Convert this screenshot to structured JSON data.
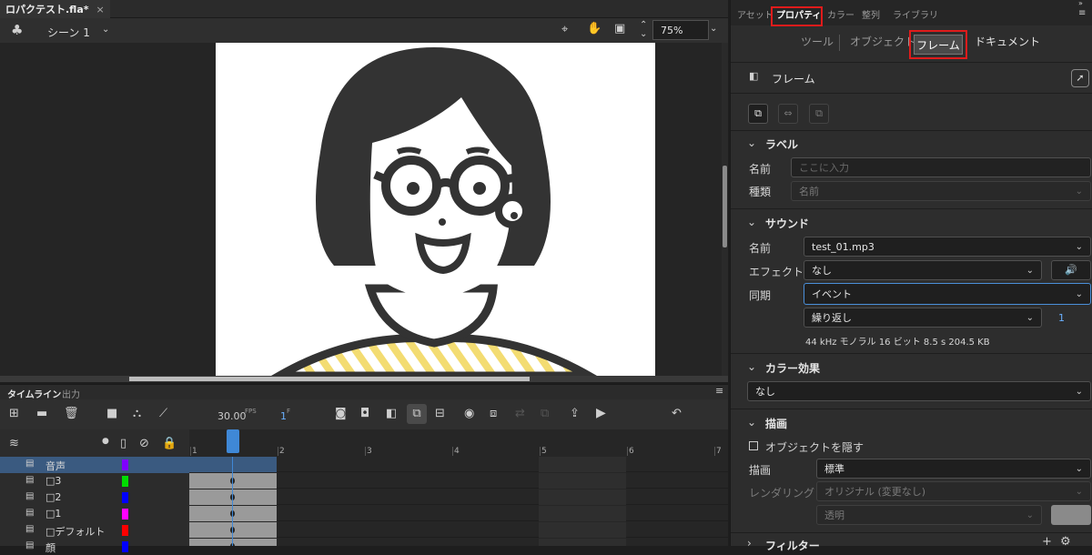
{
  "doc": {
    "tab_title": "ロパクテスト.fla*",
    "close": "×"
  },
  "editbar": {
    "scene": "シーン 1",
    "zoom": "75%"
  },
  "timeline": {
    "tab": "タイムライン",
    "tab2": "出力",
    "fps": "30.00",
    "fps_unit": "FPS",
    "frame": "1",
    "frame_unit": "F",
    "layers": [
      {
        "name": "音声",
        "color": "#7f00ff"
      },
      {
        "name": "□3",
        "color": "#00dd00"
      },
      {
        "name": "□2",
        "color": "#0000ff"
      },
      {
        "name": "□1",
        "color": "#ff00ff"
      },
      {
        "name": "□デフォルト",
        "color": "#ff0000"
      },
      {
        "name": "顔",
        "color": "#0000ff"
      }
    ],
    "frame_numbers": [
      "1",
      "2",
      "3",
      "4",
      "5",
      "6",
      "7"
    ]
  },
  "panel": {
    "tabs": [
      "アセット",
      "プロパティ",
      "カラー",
      "整列",
      "ライブラリ"
    ],
    "subtabs": [
      "ツール",
      "オブジェクト",
      "フレーム",
      "ドキュメント"
    ],
    "frame_title": "フレーム",
    "label_section": "ラベル",
    "label_name": "名前",
    "label_placeholder": "ここに入力",
    "label_type": "種類",
    "label_type_value": "名前",
    "sound_section": "サウンド",
    "sound_name_label": "名前",
    "sound_name": "test_01.mp3",
    "effect_label": "エフェクト",
    "effect_value": "なし",
    "sync_label": "同期",
    "sync_value": "イベント",
    "repeat_value": "繰り返し",
    "repeat_count": "1",
    "sound_info": "44 kHz モノラル 16 ビット 8.5 s 204.5 KB",
    "color_section": "カラー効果",
    "color_value": "なし",
    "draw_section": "描画",
    "hide_object": "オブジェクトを隠す",
    "draw_label": "描画",
    "draw_value": "標準",
    "render_label": "レンダリング",
    "render_value": "オリジナル (変更なし)",
    "transparent_value": "透明",
    "filter_section": "フィルター"
  }
}
